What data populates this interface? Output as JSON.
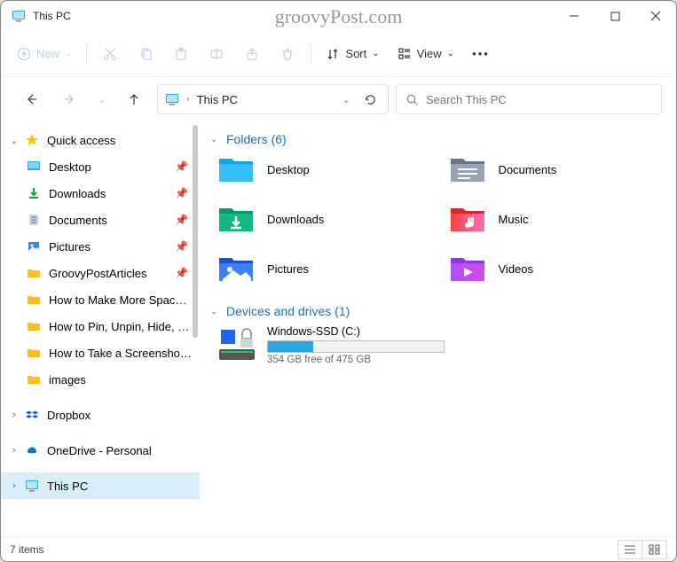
{
  "watermark": "groovyPost.com",
  "window": {
    "title": "This PC"
  },
  "toolbar": {
    "new_label": "New",
    "sort_label": "Sort",
    "view_label": "View"
  },
  "nav": {
    "address": "This PC",
    "search_placeholder": "Search This PC"
  },
  "sidebar": {
    "quick_access": "Quick access",
    "items": [
      {
        "label": "Desktop"
      },
      {
        "label": "Downloads"
      },
      {
        "label": "Documents"
      },
      {
        "label": "Pictures"
      },
      {
        "label": "GroovyPostArticles"
      },
      {
        "label": "How to Make More Space Av"
      },
      {
        "label": "How to Pin, Unpin, Hide, and"
      },
      {
        "label": "How to Take a Screenshot on"
      },
      {
        "label": "images"
      }
    ],
    "dropbox": "Dropbox",
    "onedrive": "OneDrive - Personal",
    "this_pc": "This PC"
  },
  "main": {
    "folders_header": "Folders (6)",
    "folders": [
      {
        "label": "Desktop"
      },
      {
        "label": "Documents"
      },
      {
        "label": "Downloads"
      },
      {
        "label": "Music"
      },
      {
        "label": "Pictures"
      },
      {
        "label": "Videos"
      }
    ],
    "drives_header": "Devices and drives (1)",
    "drive": {
      "label": "Windows-SSD (C:)",
      "subtext": "354 GB free of 475 GB"
    }
  },
  "status": {
    "text": "7 items"
  }
}
